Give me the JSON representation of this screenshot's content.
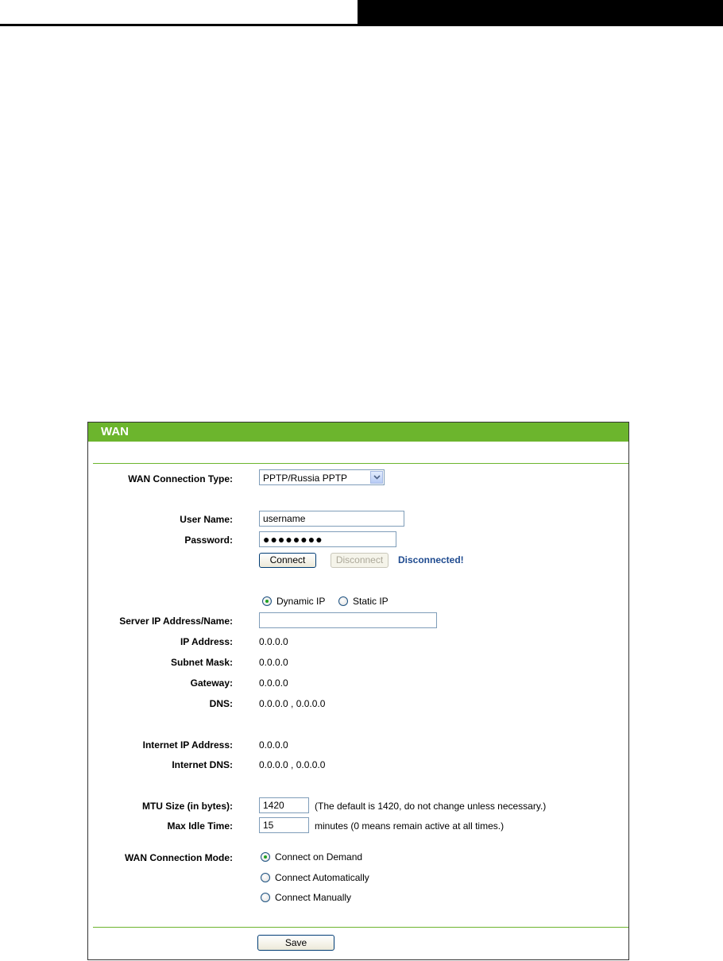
{
  "panel": {
    "title": "WAN"
  },
  "connection_type": {
    "label": "WAN Connection Type:",
    "selected": "PPTP/Russia PPTP"
  },
  "account": {
    "username_label": "User Name:",
    "username_value": "username",
    "password_label": "Password:",
    "password_value": "●●●●●●●●"
  },
  "actions": {
    "connect_label": "Connect",
    "disconnect_label": "Disconnect",
    "status_text": "Disconnected!"
  },
  "ip_mode": {
    "dynamic_label": "Dynamic IP",
    "static_label": "Static IP",
    "selected": "Dynamic IP"
  },
  "server": {
    "label": "Server IP Address/Name:",
    "value": ""
  },
  "network": {
    "ip_label": "IP Address:",
    "ip_value": "0.0.0.0",
    "mask_label": "Subnet Mask:",
    "mask_value": "0.0.0.0",
    "gateway_label": "Gateway:",
    "gateway_value": "0.0.0.0",
    "dns_label": "DNS:",
    "dns_value": "0.0.0.0 , 0.0.0.0"
  },
  "internet": {
    "ip_label": "Internet IP Address:",
    "ip_value": "0.0.0.0",
    "dns_label": "Internet DNS:",
    "dns_value": "0.0.0.0 , 0.0.0.0"
  },
  "mtu": {
    "label": "MTU Size (in bytes):",
    "value": "1420",
    "hint": "(The default is 1420, do not change unless necessary.)"
  },
  "idle": {
    "label": "Max Idle Time:",
    "value": "15",
    "hint": "minutes (0 means remain active at all times.)"
  },
  "mode": {
    "label": "WAN Connection Mode:",
    "options": [
      "Connect on Demand",
      "Connect Automatically",
      "Connect Manually"
    ],
    "selected": "Connect on Demand"
  },
  "save": {
    "label": "Save"
  }
}
